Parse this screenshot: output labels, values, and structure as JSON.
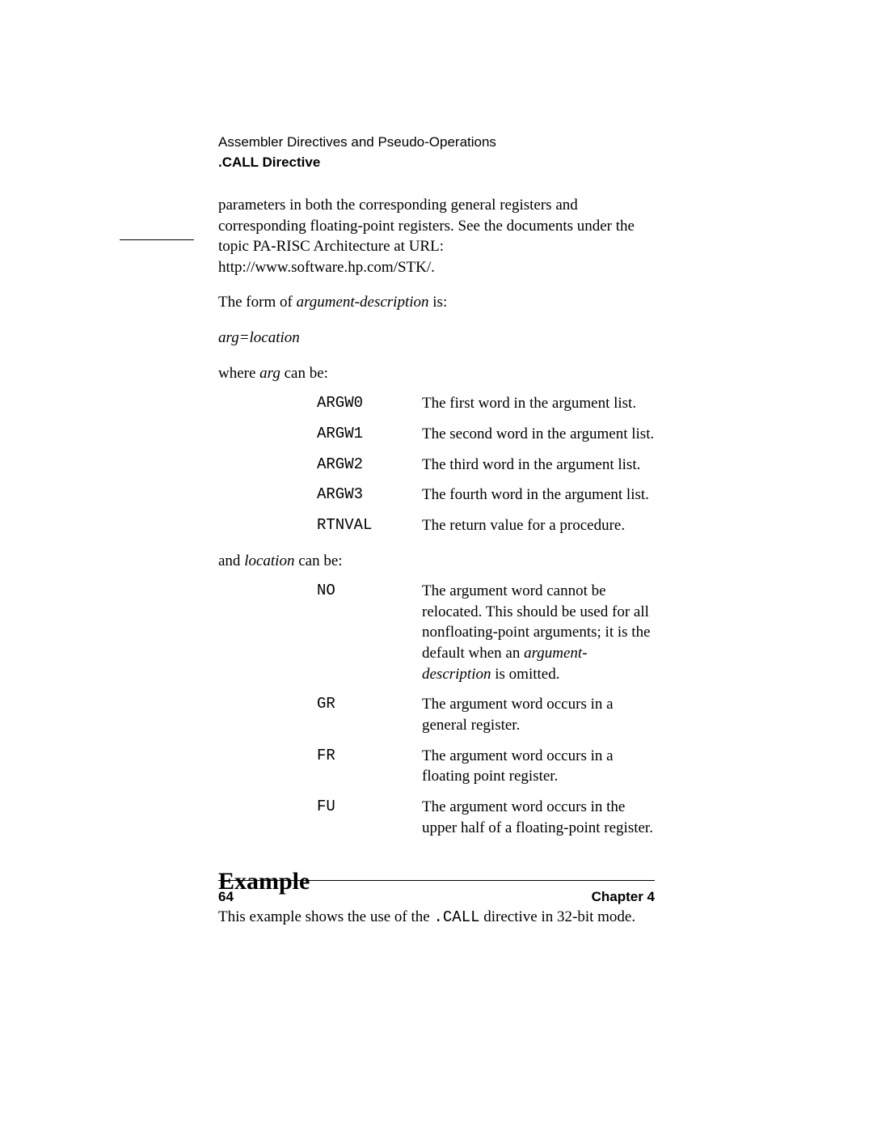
{
  "header": {
    "chapter_title": "Assembler Directives and Pseudo-Operations",
    "section_title": ".CALL Directive"
  },
  "intro_para": "parameters in both the corresponding general registers and corresponding floating-point registers. See the documents under the topic PA-RISC Architecture at URL:  http://www.software.hp.com/STK/.",
  "form_line_pre": "The form of ",
  "form_line_ital": "argument-description",
  "form_line_post": " is:",
  "arg_eq_loc": "arg=location",
  "where_pre": "where ",
  "where_ital": "arg",
  "where_post": " can be:",
  "arg_table": [
    {
      "code": "ARGW0",
      "desc": "The first word in the argument list."
    },
    {
      "code": "ARGW1",
      "desc": "The second word in the argument list."
    },
    {
      "code": "ARGW2",
      "desc": "The third word in the argument list."
    },
    {
      "code": "ARGW3",
      "desc": "The fourth word in the argument list."
    },
    {
      "code": "RTNVAL",
      "desc": "The return value for a procedure."
    }
  ],
  "and_pre": "and ",
  "and_ital": "location",
  "and_post": " can be:",
  "loc_table": {
    "no": {
      "code": "NO",
      "desc_a": "The argument word cannot be relocated. This should be used for all nonfloating-point arguments; it is the default when an",
      "desc_ital": "argument-description",
      "desc_b": " is omitted."
    },
    "gr": {
      "code": "GR",
      "desc": "The argument word occurs in a general register."
    },
    "fr": {
      "code": "FR",
      "desc": "The argument word occurs in a floating point register."
    },
    "fu": {
      "code": "FU",
      "desc": "The argument word occurs in the upper half of a floating-point register."
    }
  },
  "example_heading": "Example",
  "example_para_a": "This example shows the use of the ",
  "example_code": ".CALL",
  "example_para_b": " directive in 32-bit mode.",
  "footer": {
    "page": "64",
    "chapter": "Chapter 4"
  }
}
